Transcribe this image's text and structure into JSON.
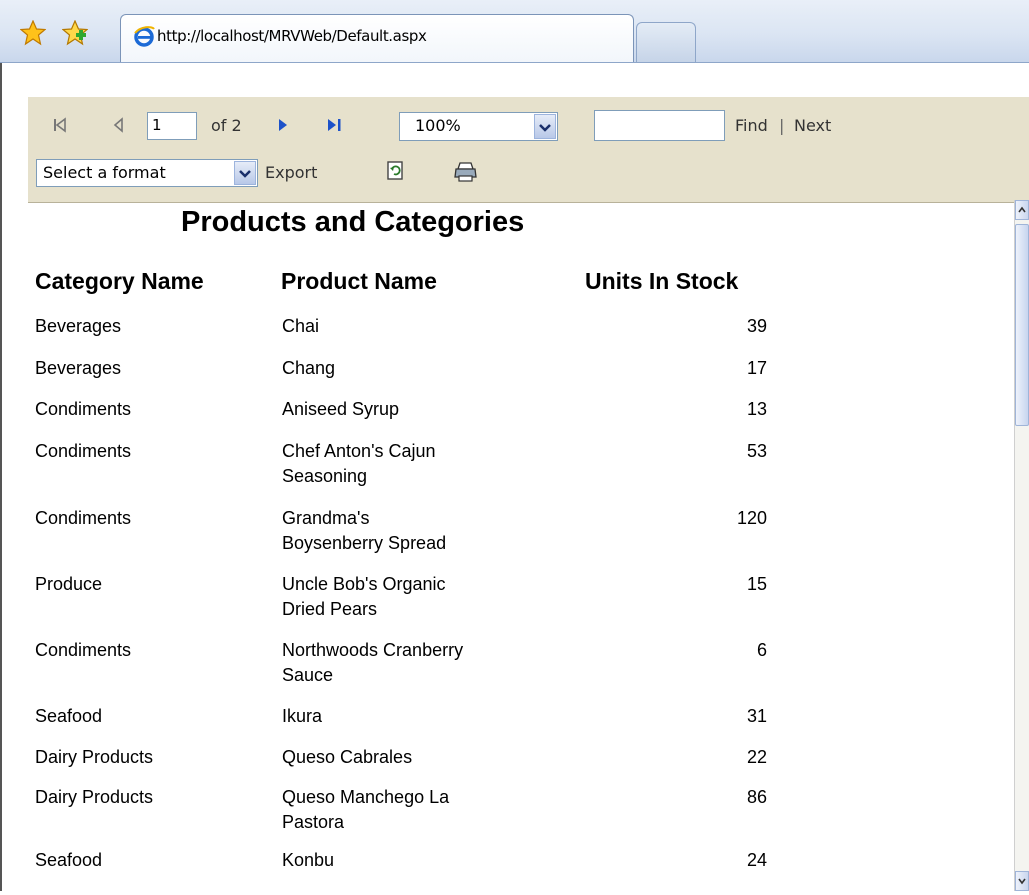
{
  "browser": {
    "tab_title": "http://localhost/MRVWeb/Default.aspx"
  },
  "toolbar": {
    "page_current": "1",
    "page_of": "of 2",
    "zoom": "100%",
    "find_query": "",
    "find_label": "Find",
    "separator": "|",
    "next_label": "Next",
    "format_selected": "Select a format",
    "export_label": "Export"
  },
  "report": {
    "title": "Products and Categories",
    "columns": [
      "Category Name",
      "Product Name",
      "Units In Stock"
    ],
    "rows": [
      {
        "category": "Beverages",
        "product": [
          "Chai"
        ],
        "units": "39"
      },
      {
        "category": "Beverages",
        "product": [
          "Chang"
        ],
        "units": "17"
      },
      {
        "category": "Condiments",
        "product": [
          "Aniseed Syrup"
        ],
        "units": "13"
      },
      {
        "category": "Condiments",
        "product": [
          "Chef Anton's Cajun",
          "Seasoning"
        ],
        "units": "53"
      },
      {
        "category": "Condiments",
        "product": [
          "Grandma's",
          "Boysenberry Spread"
        ],
        "units": "120"
      },
      {
        "category": "Produce",
        "product": [
          "Uncle Bob's Organic",
          "Dried Pears"
        ],
        "units": "15"
      },
      {
        "category": "Condiments",
        "product": [
          "Northwoods Cranberry",
          "Sauce"
        ],
        "units": "6"
      },
      {
        "category": "Seafood",
        "product": [
          "Ikura"
        ],
        "units": "31"
      },
      {
        "category": "Dairy Products",
        "product": [
          "Queso Cabrales"
        ],
        "units": "22"
      },
      {
        "category": "Dairy Products",
        "product": [
          "Queso Manchego La",
          "Pastora"
        ],
        "units": "86"
      },
      {
        "category": "Seafood",
        "product": [
          "Konbu"
        ],
        "units": "24"
      }
    ]
  },
  "colors": {
    "toolbar_bg": "#e6e1cc",
    "nav_arrow": "#1d52c9"
  },
  "icons": {
    "favorites": "favorites-star-icon",
    "add_favorite": "add-favorite-star-icon",
    "ie": "internet-explorer-icon",
    "first_page": "first-page-icon",
    "prev_page": "previous-page-icon",
    "next_page": "next-page-icon",
    "last_page": "last-page-icon",
    "refresh": "refresh-icon",
    "print": "print-icon"
  }
}
